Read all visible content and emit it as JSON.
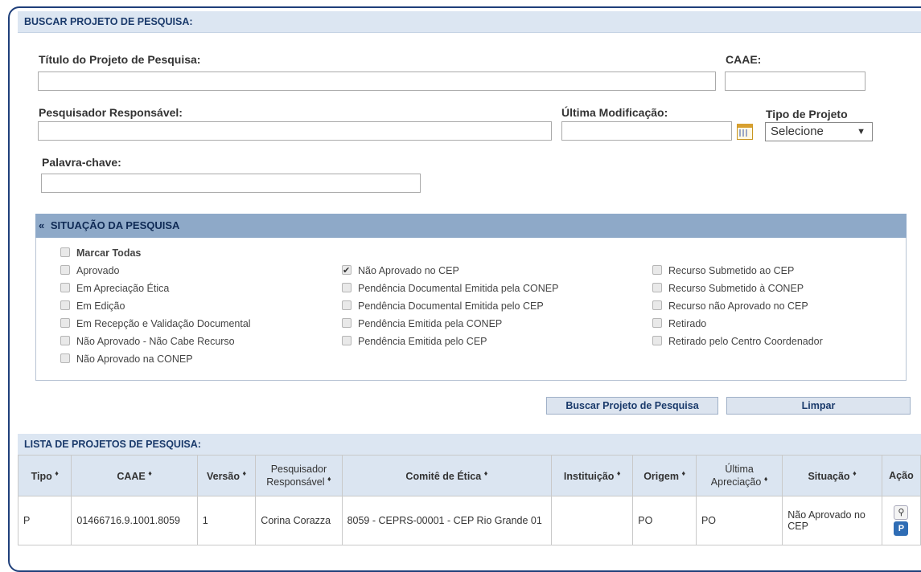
{
  "search_panel": {
    "title": "BUSCAR PROJETO DE PESQUISA:",
    "titulo_label": "Título do Projeto de Pesquisa:",
    "titulo_value": "",
    "caae_label": "CAAE:",
    "caae_value": "",
    "pesquisador_label": "Pesquisador Responsável:",
    "pesquisador_value": "",
    "ultima_mod_label": "Última Modificação:",
    "ultima_mod_value": "",
    "tipo_label": "Tipo de Projeto",
    "tipo_value": "Selecione",
    "palavra_label": "Palavra-chave:",
    "palavra_value": ""
  },
  "situacao": {
    "title": "SITUAÇÃO DA PESQUISA",
    "collapse_glyph": "«",
    "col1": [
      {
        "label": "Marcar Todas",
        "checked": false,
        "bold": true
      },
      {
        "label": "Aprovado",
        "checked": false
      },
      {
        "label": "Em Apreciação Ética",
        "checked": false
      },
      {
        "label": "Em Edição",
        "checked": false
      },
      {
        "label": "Em Recepção e Validação Documental",
        "checked": false
      },
      {
        "label": "Não Aprovado - Não Cabe Recurso",
        "checked": false
      },
      {
        "label": "Não Aprovado na CONEP",
        "checked": false
      }
    ],
    "col2": [
      {
        "label": "Não Aprovado no CEP",
        "checked": true
      },
      {
        "label": "Pendência Documental Emitida pela CONEP",
        "checked": false
      },
      {
        "label": "Pendência Documental Emitida pelo CEP",
        "checked": false
      },
      {
        "label": "Pendência Emitida pela CONEP",
        "checked": false
      },
      {
        "label": "Pendência Emitida pelo CEP",
        "checked": false
      }
    ],
    "col3": [
      {
        "label": "Recurso Submetido ao CEP",
        "checked": false
      },
      {
        "label": "Recurso Submetido à CONEP",
        "checked": false
      },
      {
        "label": "Recurso não Aprovado no CEP",
        "checked": false
      },
      {
        "label": "Retirado",
        "checked": false
      },
      {
        "label": "Retirado pelo Centro Coordenador",
        "checked": false
      }
    ]
  },
  "buttons": {
    "buscar": "Buscar Projeto de Pesquisa",
    "limpar": "Limpar"
  },
  "list_panel": {
    "title": "LISTA DE PROJETOS DE PESQUISA:",
    "sort_glyph": "♦",
    "headers": {
      "tipo": "Tipo",
      "caae": "CAAE",
      "versao": "Versão",
      "pesquisador_l1": "Pesquisador",
      "pesquisador_l2": "Responsável",
      "comite": "Comitê de Ética",
      "instituicao": "Instituição",
      "origem": "Origem",
      "ultima_l1": "Última",
      "ultima_l2": "Apreciação",
      "situacao": "Situação",
      "acao": "Ação"
    },
    "rows": [
      {
        "tipo": "P",
        "caae": "01466716.9.1001.8059",
        "versao": "1",
        "pesquisador": "Corina Corazza",
        "comite": "8059 - CEPRS-00001 - CEP Rio Grande 01",
        "instituicao": "",
        "origem": "PO",
        "ultima": "PO",
        "situacao": "Não Aprovado no CEP"
      }
    ],
    "action_icons": [
      "magnifier-icon",
      "project-document-icon"
    ]
  }
}
